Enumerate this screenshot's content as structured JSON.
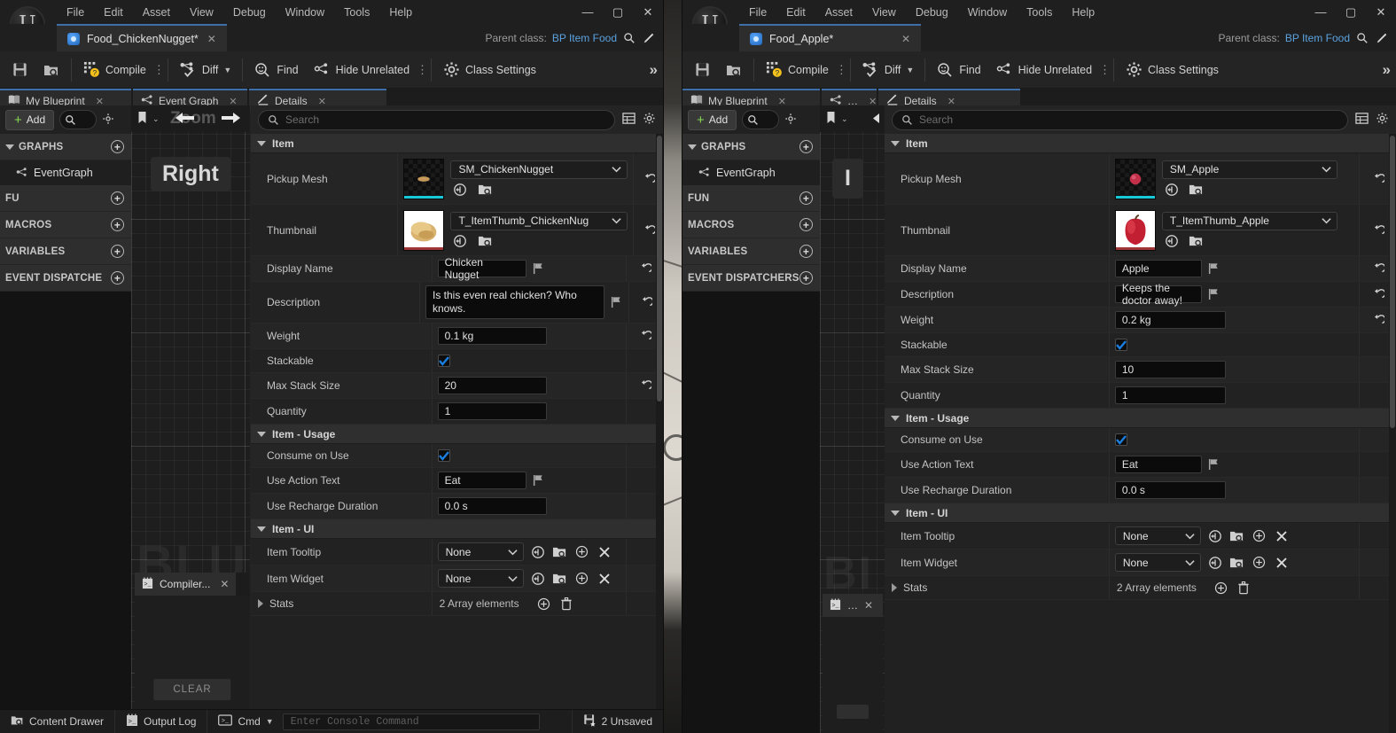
{
  "background": {
    "scene": "3d-viewport-floor"
  },
  "windows": [
    {
      "id": "left",
      "menu": [
        "File",
        "Edit",
        "Asset",
        "View",
        "Debug",
        "Window",
        "Tools",
        "Help"
      ],
      "window_controls": {
        "minimize": "—",
        "maximize": "▢",
        "close": "✕"
      },
      "asset_tab": {
        "title": "Food_ChickenNugget*",
        "close": "✕"
      },
      "parent_class": {
        "label": "Parent class:",
        "value": "BP Item Food"
      },
      "toolbar": {
        "save": "save-icon",
        "browse": "browse-icon",
        "compile": "Compile",
        "diff": "Diff",
        "find": "Find",
        "hide_unrelated": "Hide Unrelated",
        "class_settings": "Class Settings",
        "more": "»"
      },
      "panel_tabs": [
        {
          "label": "My Blueprint",
          "icon": "book-icon",
          "close": "✕"
        },
        {
          "label": "Event Graph",
          "icon": "graph-icon",
          "close": "✕"
        },
        {
          "label": "Details",
          "icon": "details-icon",
          "close": "✕"
        }
      ],
      "my_blueprint": {
        "add_label": "Add",
        "sections": [
          {
            "label": "GRAPHS",
            "expanded": true,
            "add": "+"
          },
          {
            "label": "FU",
            "expanded": false,
            "add": "+"
          },
          {
            "label": "MACROS",
            "expanded": false,
            "add": "+"
          },
          {
            "label": "VARIABLES",
            "expanded": false,
            "add": "+"
          },
          {
            "label": "EVENT DISPATCHE",
            "expanded": false,
            "add": "+"
          }
        ],
        "graph_items": [
          {
            "label": "EventGraph"
          }
        ]
      },
      "graph": {
        "zoom_label": "Zoom",
        "node_label": "Right",
        "watermark": "BLU"
      },
      "compiler_panel": {
        "tab_label": "Compiler...",
        "close": "✕",
        "clear_button": "CLEAR"
      },
      "details": {
        "search_placeholder": "Search",
        "categories": [
          {
            "name": "Item",
            "rows": [
              {
                "name": "Pickup Mesh",
                "type": "asset",
                "value": "SM_ChickenNugget",
                "thumb": "mesh",
                "thumb_color": "#c79a5a",
                "bar_color": "#17c8d8",
                "reset": true
              },
              {
                "name": "Thumbnail",
                "type": "asset",
                "value": "T_ItemThumb_ChickenNug",
                "thumb": "texture",
                "thumb_color": "#e0c07e",
                "bar_color": "#a03535",
                "reset": true
              },
              {
                "name": "Display Name",
                "type": "text-flag",
                "value": "Chicken Nugget",
                "reset": true
              },
              {
                "name": "Description",
                "type": "text-flag-multi",
                "value": "Is this even real chicken? Who knows.",
                "reset": true
              },
              {
                "name": "Weight",
                "type": "text",
                "value": "0.1 kg",
                "reset": true
              },
              {
                "name": "Stackable",
                "type": "checkbox",
                "checked": true,
                "reset": false
              },
              {
                "name": "Max Stack Size",
                "type": "text",
                "value": "20",
                "reset": true
              },
              {
                "name": "Quantity",
                "type": "text",
                "value": "1",
                "reset": false
              }
            ]
          },
          {
            "name": "Item - Usage",
            "rows": [
              {
                "name": "Consume on Use",
                "type": "checkbox",
                "checked": true,
                "reset": false
              },
              {
                "name": "Use Action Text",
                "type": "text-flag",
                "value": "Eat",
                "reset": false
              },
              {
                "name": "Use Recharge Duration",
                "type": "text",
                "value": "0.0 s",
                "reset": false
              }
            ]
          },
          {
            "name": "Item - UI",
            "rows": [
              {
                "name": "Item Tooltip",
                "type": "objpick",
                "value": "None",
                "reset": false
              },
              {
                "name": "Item Widget",
                "type": "objpick",
                "value": "None",
                "reset": false
              },
              {
                "name": "Stats",
                "type": "array",
                "value": "2 Array elements",
                "expandable": true,
                "reset": false
              }
            ]
          }
        ]
      },
      "status_bar": {
        "content_drawer": "Content Drawer",
        "output_log": "Output Log",
        "cmd": "Cmd",
        "console_placeholder": "Enter Console Command",
        "unsaved": "2 Unsaved"
      }
    },
    {
      "id": "right",
      "menu": [
        "File",
        "Edit",
        "Asset",
        "View",
        "Debug",
        "Window",
        "Tools",
        "Help"
      ],
      "window_controls": {
        "minimize": "—",
        "maximize": "▢",
        "close": "✕"
      },
      "asset_tab": {
        "title": "Food_Apple*",
        "close": "✕"
      },
      "parent_class": {
        "label": "Parent class:",
        "value": "BP Item Food"
      },
      "toolbar": {
        "save": "save-icon",
        "browse": "browse-icon",
        "compile": "Compile",
        "diff": "Diff",
        "find": "Find",
        "hide_unrelated": "Hide Unrelated",
        "class_settings": "Class Settings",
        "more": "»"
      },
      "panel_tabs": [
        {
          "label": "My Blueprint",
          "icon": "book-icon",
          "close": "✕"
        },
        {
          "label": "…",
          "icon": "graph-icon",
          "close": "✕"
        },
        {
          "label": "Details",
          "icon": "details-icon",
          "close": "✕"
        }
      ],
      "my_blueprint": {
        "add_label": "Add",
        "sections": [
          {
            "label": "GRAPHS",
            "expanded": true,
            "add": "+"
          },
          {
            "label": "FUN",
            "expanded": false,
            "add": "+"
          },
          {
            "label": "MACROS",
            "expanded": false,
            "add": "+"
          },
          {
            "label": "VARIABLES",
            "expanded": false,
            "add": "+"
          },
          {
            "label": "EVENT DISPATCHERS",
            "expanded": false,
            "add": "+"
          }
        ],
        "graph_items": [
          {
            "label": "EventGraph"
          }
        ]
      },
      "graph": {
        "zoom_label": "",
        "node_label": "I",
        "watermark": "BI"
      },
      "compiler_panel": {
        "tab_label": "…",
        "close": "✕",
        "clear_button": ""
      },
      "details": {
        "search_placeholder": "Search",
        "categories": [
          {
            "name": "Item",
            "rows": [
              {
                "name": "Pickup Mesh",
                "type": "asset",
                "value": "SM_Apple",
                "thumb": "mesh",
                "thumb_color": "#c2304a",
                "bar_color": "#17c8d8",
                "reset": true
              },
              {
                "name": "Thumbnail",
                "type": "asset",
                "value": "T_ItemThumb_Apple",
                "thumb": "texture",
                "thumb_color": "#c21f33",
                "bar_color": "#a03535",
                "reset": true
              },
              {
                "name": "Display Name",
                "type": "text-flag",
                "value": "Apple",
                "reset": true
              },
              {
                "name": "Description",
                "type": "text-flag",
                "value": "Keeps the doctor away!",
                "reset": true
              },
              {
                "name": "Weight",
                "type": "text",
                "value": "0.2 kg",
                "reset": true
              },
              {
                "name": "Stackable",
                "type": "checkbox",
                "checked": true,
                "reset": false
              },
              {
                "name": "Max Stack Size",
                "type": "text",
                "value": "10",
                "reset": false
              },
              {
                "name": "Quantity",
                "type": "text",
                "value": "1",
                "reset": false
              }
            ]
          },
          {
            "name": "Item - Usage",
            "rows": [
              {
                "name": "Consume on Use",
                "type": "checkbox",
                "checked": true,
                "reset": false
              },
              {
                "name": "Use Action Text",
                "type": "text-flag",
                "value": "Eat",
                "reset": false
              },
              {
                "name": "Use Recharge Duration",
                "type": "text",
                "value": "0.0 s",
                "reset": false
              }
            ]
          },
          {
            "name": "Item - UI",
            "rows": [
              {
                "name": "Item Tooltip",
                "type": "objpick",
                "value": "None",
                "reset": false
              },
              {
                "name": "Item Widget",
                "type": "objpick",
                "value": "None",
                "reset": false
              },
              {
                "name": "Stats",
                "type": "array",
                "value": "2 Array elements",
                "expandable": true,
                "reset": false
              }
            ]
          }
        ]
      },
      "status_bar": null
    }
  ],
  "colors": {
    "accent_blue": "#3f6fa8",
    "link_blue": "#5aa2e0",
    "checkbox_blue": "#1a7fe0",
    "add_green": "#86d654",
    "compile_yellow": "#f2c11c",
    "mesh_bar_cyan": "#17c8d8",
    "texture_bar_red": "#a03535"
  }
}
